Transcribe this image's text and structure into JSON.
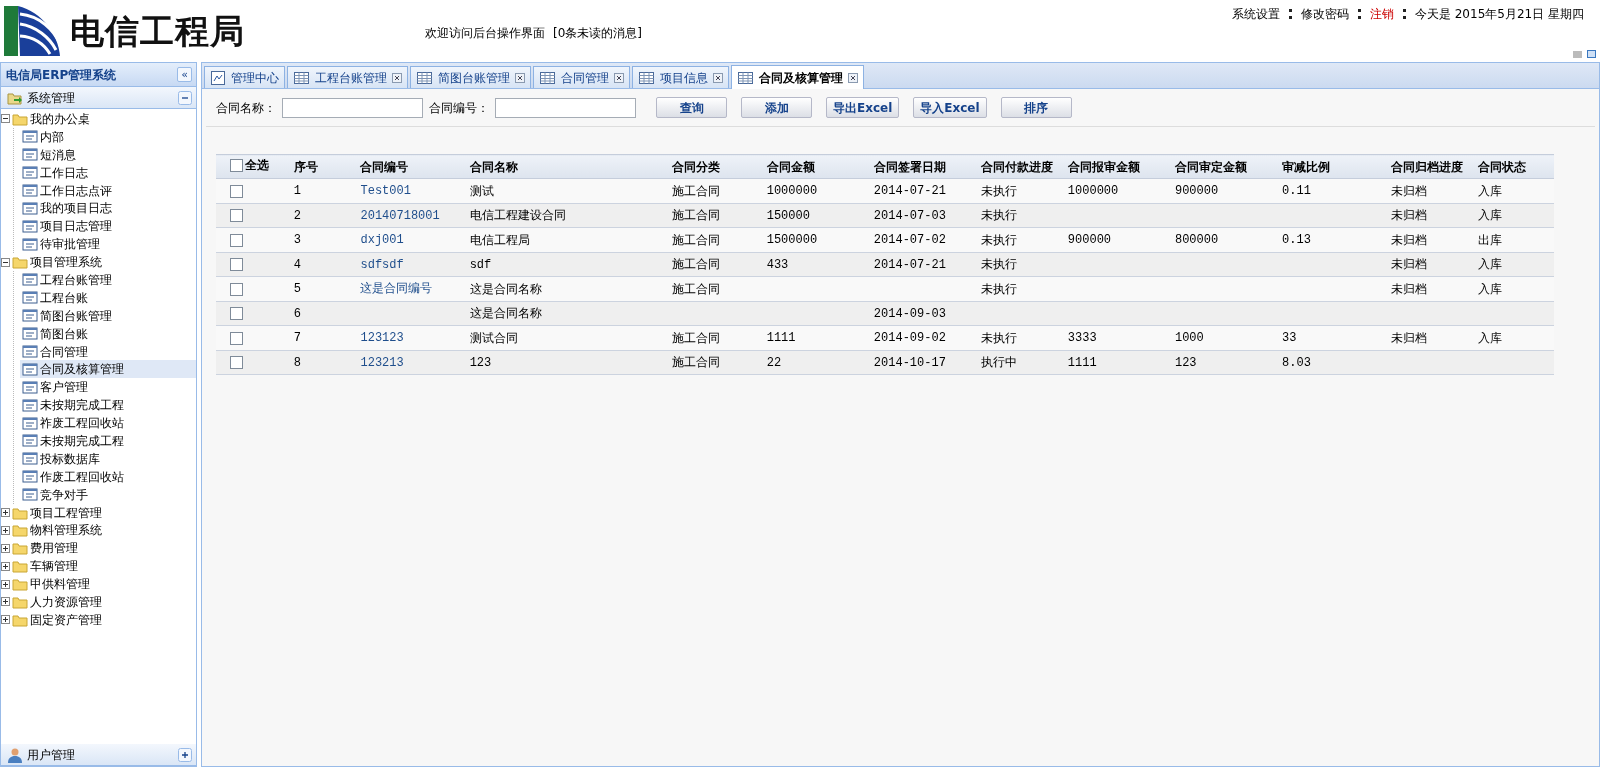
{
  "header": {
    "logo_text": "电信工程局",
    "welcome": "欢迎访问后台操作界面",
    "messages": "[0条未读的消息]",
    "top_links": [
      {
        "label": "系统设置",
        "kind": "link"
      },
      {
        "label": "修改密码",
        "kind": "link"
      },
      {
        "label": "注销",
        "kind": "alert"
      }
    ],
    "date": "今天是 2015年5月21日 星期四"
  },
  "sidebar": {
    "title": "电信局ERP管理系统",
    "collapse_button": "«",
    "panel": {
      "title": "系统管理",
      "expanded": true
    },
    "tree": [
      {
        "label": "我的办公桌",
        "kind": "folder",
        "expanded": true,
        "selected": false,
        "children": [
          {
            "label": "内部",
            "kind": "page",
            "selected": false
          },
          {
            "label": "短消息",
            "kind": "page",
            "selected": false
          },
          {
            "label": "工作日志",
            "kind": "page",
            "selected": false
          },
          {
            "label": "工作日志点评",
            "kind": "page",
            "selected": false
          },
          {
            "label": "我的项目日志",
            "kind": "page",
            "selected": false
          },
          {
            "label": "项目日志管理",
            "kind": "page",
            "selected": false
          },
          {
            "label": "待审批管理",
            "kind": "page",
            "selected": false
          }
        ]
      },
      {
        "label": "项目管理系统",
        "kind": "folder",
        "expanded": true,
        "selected": false,
        "children": [
          {
            "label": "工程台账管理",
            "kind": "page",
            "selected": false
          },
          {
            "label": "工程台账",
            "kind": "page",
            "selected": false
          },
          {
            "label": "简图台账管理",
            "kind": "page",
            "selected": false
          },
          {
            "label": "简图台账",
            "kind": "page",
            "selected": false
          },
          {
            "label": "合同管理",
            "kind": "page",
            "selected": false
          },
          {
            "label": "合同及核算管理",
            "kind": "page",
            "selected": true
          },
          {
            "label": "客户管理",
            "kind": "page",
            "selected": false
          },
          {
            "label": "未按期完成工程",
            "kind": "page",
            "selected": false
          },
          {
            "label": "祚废工程回收站",
            "kind": "page",
            "selected": false
          },
          {
            "label": "未按期完成工程",
            "kind": "page",
            "selected": false
          },
          {
            "label": "投标数据库",
            "kind": "page",
            "selected": false
          },
          {
            "label": "作废工程回收站",
            "kind": "page",
            "selected": false
          },
          {
            "label": "竞争对手",
            "kind": "page",
            "selected": false
          }
        ]
      },
      {
        "label": "项目工程管理",
        "kind": "folder",
        "expanded": false,
        "selected": false
      },
      {
        "label": "物料管理系统",
        "kind": "folder",
        "expanded": false,
        "selected": false
      },
      {
        "label": "费用管理",
        "kind": "folder",
        "expanded": false,
        "selected": false
      },
      {
        "label": "车辆管理",
        "kind": "folder",
        "expanded": false,
        "selected": false
      },
      {
        "label": "甲供料管理",
        "kind": "folder",
        "expanded": false,
        "selected": false
      },
      {
        "label": "人力资源管理",
        "kind": "folder",
        "expanded": false,
        "selected": false
      },
      {
        "label": "固定资产管理",
        "kind": "folder",
        "expanded": false,
        "selected": false
      }
    ],
    "bottom_panel": {
      "title": "用户管理",
      "expanded": false
    }
  },
  "tabs": [
    {
      "label": "管理中心",
      "kind": "home",
      "closable": false,
      "selected": false
    },
    {
      "label": "工程台账管理",
      "kind": "grid",
      "closable": true,
      "selected": false
    },
    {
      "label": "简图台账管理",
      "kind": "grid",
      "closable": true,
      "selected": false
    },
    {
      "label": "合同管理",
      "kind": "grid",
      "closable": true,
      "selected": false
    },
    {
      "label": "项目信息",
      "kind": "grid",
      "closable": true,
      "selected": false
    },
    {
      "label": "合同及核算管理",
      "kind": "grid",
      "closable": true,
      "selected": true
    }
  ],
  "search": {
    "fields": [
      {
        "label": "合同名称："
      },
      {
        "label": "合同编号："
      }
    ],
    "buttons": [
      "查询",
      "添加",
      "导出Excel",
      "导入Excel",
      "排序"
    ]
  },
  "table": {
    "select_all": {
      "label": "全选",
      "checked": false
    },
    "columns": [
      "序号",
      "合同编号",
      "合同名称",
      "合同分类",
      "合同金额",
      "合同签署日期",
      "合同付款进度",
      "合同报审金额",
      "合同审定金额",
      "审减比例",
      "合同归档进度",
      "合同状态"
    ],
    "rows": [
      {
        "checked": false,
        "cells": [
          "1",
          "Test001",
          "测试",
          "施工合同",
          "1000000",
          "2014-07-21",
          "未执行",
          "1000000",
          "900000",
          "0.11",
          "未归档",
          "入库"
        ]
      },
      {
        "checked": false,
        "cells": [
          "2",
          "20140718001",
          "电信工程建设合同",
          "施工合同",
          "150000",
          "2014-07-03",
          "未执行",
          "",
          "",
          "",
          "未归档",
          "入库"
        ]
      },
      {
        "checked": false,
        "cells": [
          "3",
          "dxj001",
          "电信工程局",
          "施工合同",
          "1500000",
          "2014-07-02",
          "未执行",
          "900000",
          "800000",
          "0.13",
          "未归档",
          "出库"
        ]
      },
      {
        "checked": false,
        "cells": [
          "4",
          "sdfsdf",
          "sdf",
          "施工合同",
          "433",
          "2014-07-21",
          "未执行",
          "",
          "",
          "",
          "未归档",
          "入库"
        ]
      },
      {
        "checked": false,
        "cells": [
          "5",
          "这是合同编号",
          "这是合同名称",
          "施工合同",
          "",
          "",
          "未执行",
          "",
          "",
          "",
          "未归档",
          "入库"
        ]
      },
      {
        "checked": false,
        "cells": [
          "6",
          "",
          "这是合同名称",
          "",
          "",
          "2014-09-03",
          "",
          "",
          "",
          "",
          "",
          ""
        ]
      },
      {
        "checked": false,
        "cells": [
          "7",
          "123123",
          "测试合同",
          "施工合同",
          "1111",
          "2014-09-02",
          "未执行",
          "3333",
          "1000",
          "33",
          "未归档",
          "入库"
        ]
      },
      {
        "checked": false,
        "cells": [
          "8",
          "123213",
          "123",
          "施工合同",
          "22",
          "2014-10-17",
          "执行中",
          "1111",
          "123",
          "8.03",
          "",
          ""
        ]
      }
    ]
  }
}
